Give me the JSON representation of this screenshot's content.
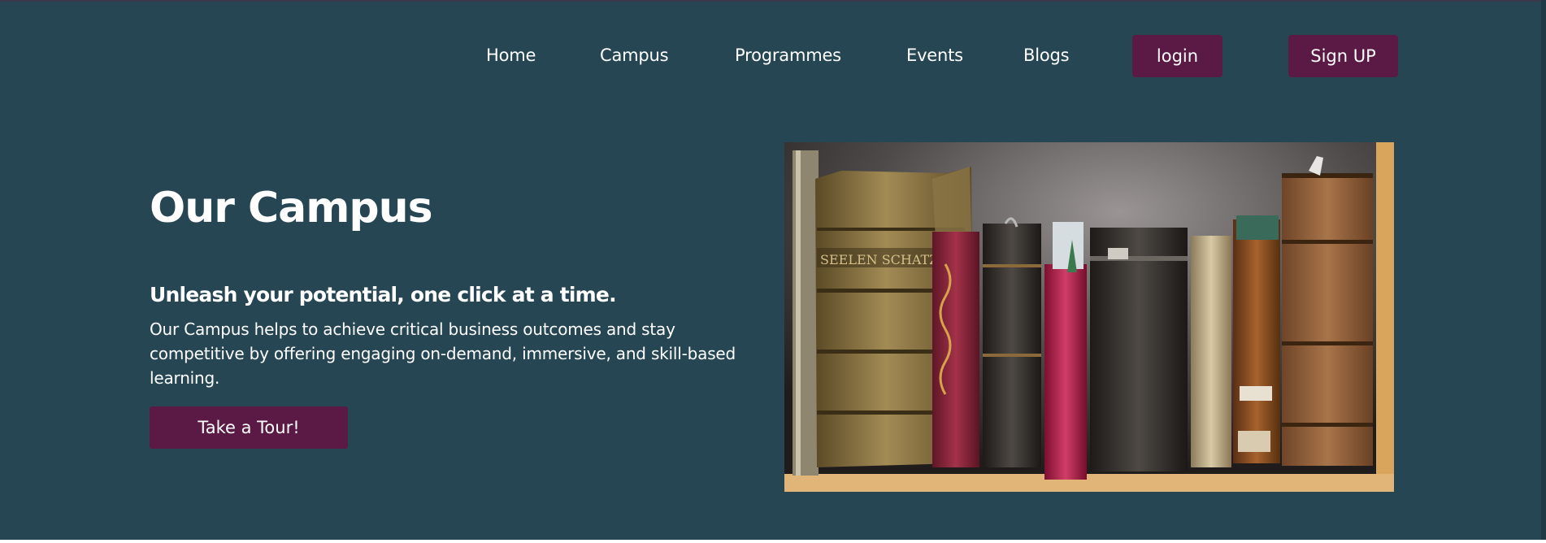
{
  "nav": {
    "links": [
      "Home",
      "Campus",
      "Programmes",
      "Events",
      "Blogs"
    ],
    "login_label": "login",
    "signup_label": "Sign UP"
  },
  "hero": {
    "title": "Our Campus",
    "tagline": "Unleash your potential, one click at a time.",
    "description": "Our Campus helps to achieve critical business outcomes and stay competitive by offering engaging on-demand, immersive, and skill-based learning.",
    "cta_label": "Take a Tour!",
    "image_subject": "antique books on a shelf",
    "spine_text": "SEELEN SCHATZ"
  },
  "colors": {
    "background": "#264653",
    "button": "#5b1a45",
    "text": "#ffffff"
  }
}
